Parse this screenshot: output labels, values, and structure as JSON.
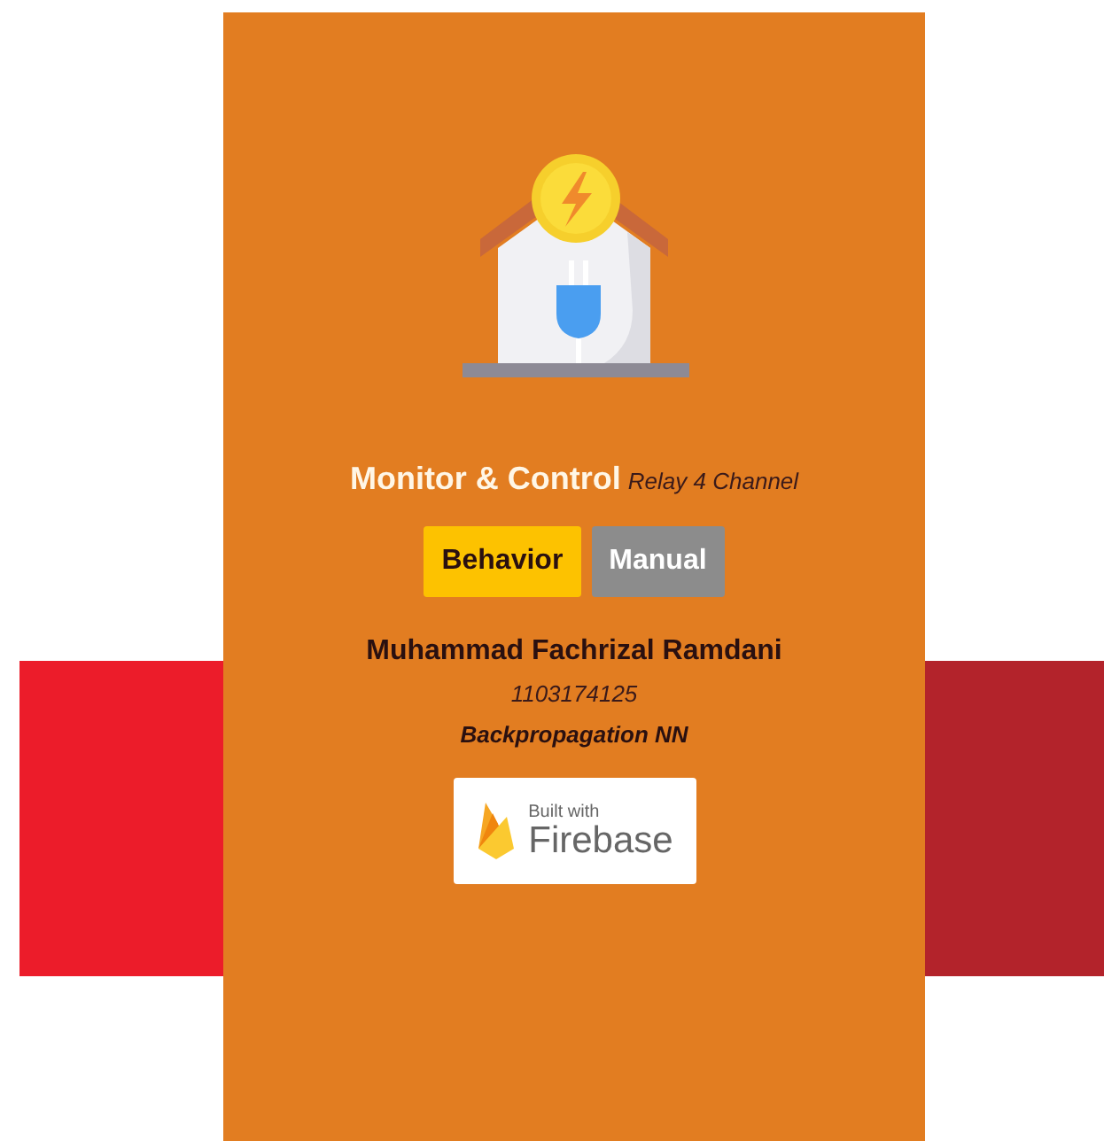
{
  "header": {
    "title": "Monitor & Control",
    "subtitle": "Relay 4 Channel"
  },
  "modes": [
    {
      "label": "Behavior",
      "selected": true
    },
    {
      "label": "Manual",
      "selected": false
    }
  ],
  "author": {
    "name": "Muhammad Fachrizal Ramdani",
    "id": "1103174125",
    "topic": "Backpropagation NN"
  },
  "badge": {
    "caption": "Built with",
    "brand": "Firebase"
  }
}
